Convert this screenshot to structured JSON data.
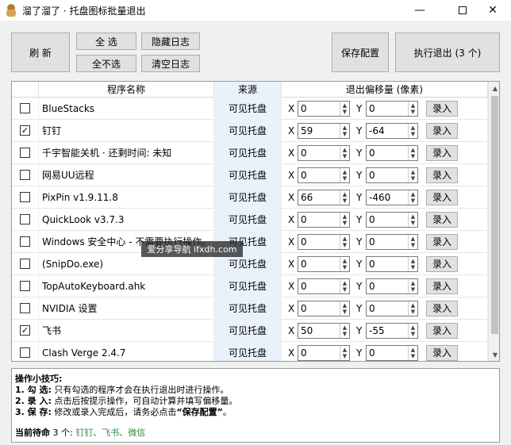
{
  "window": {
    "title": "溜了溜了 · 托盘图标批量退出"
  },
  "toolbar": {
    "refresh": "刷 新",
    "select_all": "全 选",
    "select_none": "全不选",
    "hide_log": "隐藏日志",
    "clear_log": "清空日志",
    "save_config": "保存配置",
    "run_exit": "执行退出 (3 个)"
  },
  "table": {
    "headers": [
      "程序名称",
      "来源",
      "退出偏移量 (像素)"
    ],
    "x_label": "X",
    "y_label": "Y",
    "record_label": "录入",
    "rows": [
      {
        "checked": "",
        "name": "BlueStacks",
        "source": "可见托盘",
        "x": "0",
        "y": "0"
      },
      {
        "checked": "✓",
        "name": "钉钉",
        "source": "可见托盘",
        "x": "59",
        "y": "-64"
      },
      {
        "checked": "",
        "name": "千宇智能关机 · 还剩时间: 未知",
        "source": "可见托盘",
        "x": "0",
        "y": "0"
      },
      {
        "checked": "",
        "name": "网易UU远程",
        "source": "可见托盘",
        "x": "0",
        "y": "0"
      },
      {
        "checked": "",
        "name": "PixPin v1.9.11.8",
        "source": "可见托盘",
        "x": "66",
        "y": "-460"
      },
      {
        "checked": "",
        "name": "QuickLook v3.7.3",
        "source": "可见托盘",
        "x": "0",
        "y": "0"
      },
      {
        "checked": "",
        "name": "Windows 安全中心 - 不需要执行操作。",
        "source": "可见托盘",
        "x": "0",
        "y": "0"
      },
      {
        "checked": "",
        "name": "(SnipDo.exe)",
        "source": "可见托盘",
        "x": "0",
        "y": "0"
      },
      {
        "checked": "",
        "name": "TopAutoKeyboard.ahk",
        "source": "可见托盘",
        "x": "0",
        "y": "0"
      },
      {
        "checked": "",
        "name": "NVIDIA 设置",
        "source": "可见托盘",
        "x": "0",
        "y": "0"
      },
      {
        "checked": "✓",
        "name": "飞书",
        "source": "可见托盘",
        "x": "50",
        "y": "-55"
      },
      {
        "checked": "",
        "name": "Clash Verge 2.4.7",
        "source": "可见托盘",
        "x": "0",
        "y": "0"
      }
    ]
  },
  "watermark": "爱分享导航 ifxdh.com",
  "tips": {
    "heading": "操作小技巧:",
    "l1_label": "1. 勾 选:",
    "l1_text": "只有勾选的程序才会在执行退出时进行操作。",
    "l2_label": "2. 录 入:",
    "l2_text": "点击后按提示操作，可自动计算并填写偏移量。",
    "l3_label": "3. 保 存:",
    "l3_text_a": "修改或录入完成后，请务必点击",
    "l3_bold": "“保存配置”",
    "l3_text_b": "。",
    "pending_label": "当前待命",
    "pending_count": "3 个:",
    "pending_items": "钉钉、飞书、微信"
  }
}
